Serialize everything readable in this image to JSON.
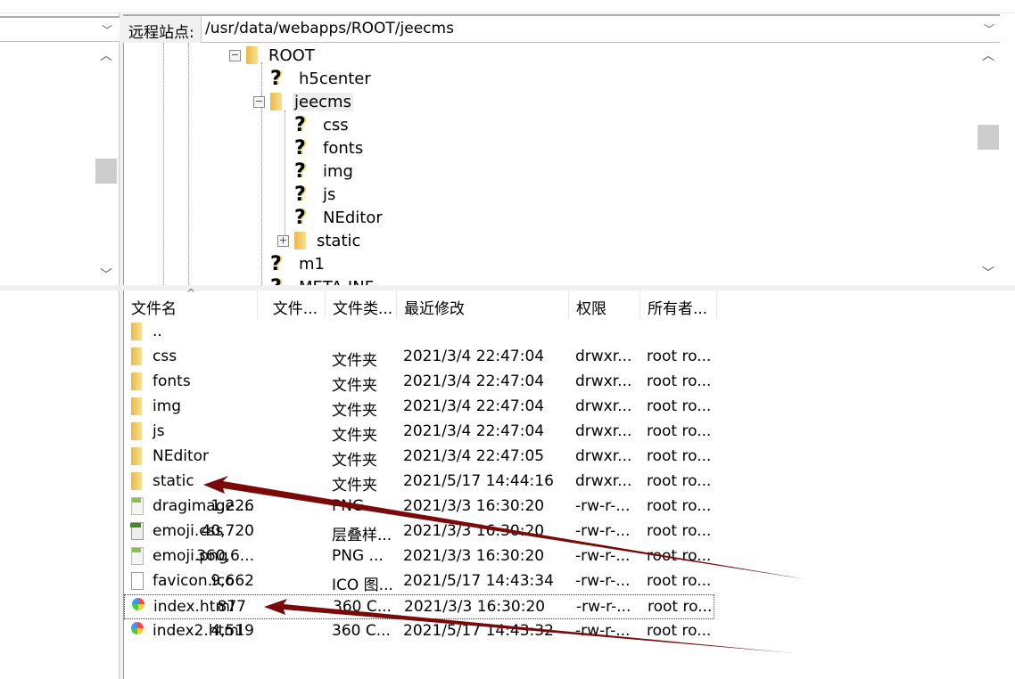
{
  "remote_site": {
    "label": "远程站点:",
    "path": "/usr/data/webapps/ROOT/jeecms"
  },
  "tree": [
    {
      "name": "ROOT",
      "icon": "folder",
      "expander": "minus",
      "depth": 0
    },
    {
      "name": "h5center",
      "icon": "question",
      "depth": 1
    },
    {
      "name": "jeecms",
      "icon": "folder",
      "expander": "minus",
      "depth": 1,
      "selected": true
    },
    {
      "name": "css",
      "icon": "question",
      "depth": 2
    },
    {
      "name": "fonts",
      "icon": "question",
      "depth": 2
    },
    {
      "name": "img",
      "icon": "question",
      "depth": 2
    },
    {
      "name": "js",
      "icon": "question",
      "depth": 2
    },
    {
      "name": "NEditor",
      "icon": "question",
      "depth": 2
    },
    {
      "name": "static",
      "icon": "folder",
      "expander": "plus",
      "depth": 2
    },
    {
      "name": "m1",
      "icon": "question",
      "depth": 1
    },
    {
      "name": "META-INF",
      "icon": "question",
      "depth": 1
    }
  ],
  "columns": [
    "文件名",
    "文件...",
    "文件类...",
    "最近修改",
    "权限",
    "所有者..."
  ],
  "files": [
    {
      "name": "..",
      "size": "",
      "type": "",
      "modified": "",
      "perm": "",
      "owner": "",
      "icon": "folder"
    },
    {
      "name": "css",
      "size": "",
      "type": "文件夹",
      "modified": "2021/3/4 22:47:04",
      "perm": "drwxr...",
      "owner": "root ro...",
      "icon": "folder"
    },
    {
      "name": "fonts",
      "size": "",
      "type": "文件夹",
      "modified": "2021/3/4 22:47:04",
      "perm": "drwxr...",
      "owner": "root ro...",
      "icon": "folder"
    },
    {
      "name": "img",
      "size": "",
      "type": "文件夹",
      "modified": "2021/3/4 22:47:04",
      "perm": "drwxr...",
      "owner": "root ro...",
      "icon": "folder"
    },
    {
      "name": "js",
      "size": "",
      "type": "文件夹",
      "modified": "2021/3/4 22:47:04",
      "perm": "drwxr...",
      "owner": "root ro...",
      "icon": "folder"
    },
    {
      "name": "NEditor",
      "size": "",
      "type": "文件夹",
      "modified": "2021/3/4 22:47:05",
      "perm": "drwxr...",
      "owner": "root ro...",
      "icon": "folder"
    },
    {
      "name": "static",
      "size": "",
      "type": "文件夹",
      "modified": "2021/5/17 14:44:16",
      "perm": "drwxr...",
      "owner": "root ro...",
      "icon": "folder"
    },
    {
      "name": "dragimage....",
      "size": "1,226",
      "type": "PNG ...",
      "modified": "2021/3/3 16:30:20",
      "perm": "-rw-r-...",
      "owner": "root ro...",
      "icon": "png"
    },
    {
      "name": "emoji.css",
      "size": "40,720",
      "type": "层叠样...",
      "modified": "2021/3/3 16:30:20",
      "perm": "-rw-r-...",
      "owner": "root ro...",
      "icon": "css"
    },
    {
      "name": "emoji.png",
      "size": "360,6...",
      "type": "PNG ...",
      "modified": "2021/3/3 16:30:20",
      "perm": "-rw-r-...",
      "owner": "root ro...",
      "icon": "png"
    },
    {
      "name": "favicon.ico",
      "size": "9,662",
      "type": "ICO 图...",
      "modified": "2021/5/17 14:43:34",
      "perm": "-rw-r-...",
      "owner": "root ro...",
      "icon": "ico"
    },
    {
      "name": "index.html",
      "size": "877",
      "type": "360 C...",
      "modified": "2021/3/3 16:30:20",
      "perm": "-rw-r-...",
      "owner": "root ro...",
      "icon": "html",
      "focused": true
    },
    {
      "name": "index2.html",
      "size": "4,519",
      "type": "360 C...",
      "modified": "2021/5/17 14:43:32",
      "perm": "-rw-r-...",
      "owner": "root ro...",
      "icon": "html"
    }
  ],
  "annotation_color": "#7a0a0a"
}
